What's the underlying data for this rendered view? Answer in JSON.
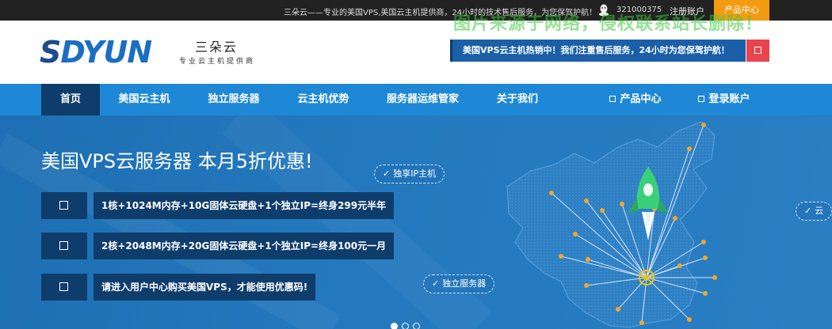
{
  "topbar": {
    "tagline": "三朵云——专业的美国VPS,美国云主机提供商，24小时的技术售后服务，为您保驾护航！",
    "qq": "321000375",
    "register": "注册账户",
    "product_center": "产品中心"
  },
  "header": {
    "logo_text_s": "S",
    "logo_text_rest": "DYUN",
    "logo_cn": "三朵云",
    "logo_sub": "专业云主机提供商",
    "watermark": "图片来源于网络，侵权联系站长删除！",
    "notice": "美国VPS云主机热销中！我们注重售后服务，24小时为您保驾护航！"
  },
  "nav": {
    "items": [
      "首页",
      "美国云主机",
      "独立服务器",
      "云主机优势",
      "服务器运维管家",
      "关于我们"
    ],
    "product_center": "产品中心",
    "login": "登录账户"
  },
  "banner": {
    "title": "美国VPS云服务器 本月5折优惠!",
    "features": [
      "1核+1024M内存+10G固体云硬盘+1个独立IP=终身299元半年",
      "2核+2048M内存+20G固体云硬盘+1个独立IP=终身100元一月",
      "请进入用户中心购买美国VPS，才能使用优惠码!"
    ],
    "pill_ip": "独享IP主机",
    "pill_server": "独立服务器",
    "pill_right": "云",
    "check": "✓"
  },
  "colors": {
    "topbar": "#222222",
    "nav": "#1e88d6",
    "nav_active": "#0f3d6b",
    "orange": "#f39c12",
    "notice": "#1a5fa8",
    "red": "#e9434d"
  }
}
